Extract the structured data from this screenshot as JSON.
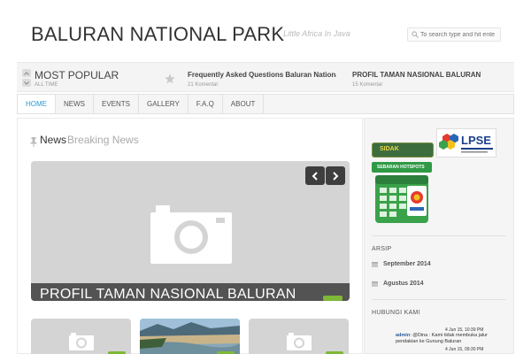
{
  "header": {
    "site_title": "BALURAN NATIONAL PARK",
    "tagline": "Little Africa In Java",
    "search_placeholder": "To search type and hit ente"
  },
  "popular": {
    "title": "MOST POPULAR",
    "subtitle": "ALL TIME",
    "items": [
      {
        "title": "Frequently Asked Questions Baluran National P",
        "comments": "21 Komentar"
      },
      {
        "title": "PROFIL TAMAN NASIONAL BALURAN",
        "comments": "15 Komentar"
      }
    ]
  },
  "nav": {
    "items": [
      "HOME",
      "NEWS",
      "EVENTS",
      "GALLERY",
      "F.A.Q",
      "ABOUT"
    ]
  },
  "main": {
    "section_title_bold": "News",
    "section_title_light": "Breaking News",
    "slider_caption": "PROFIL TAMAN NASIONAL BALURAN"
  },
  "sidebar": {
    "sidak_label": "SIDAK",
    "lpse_label": "LPSE",
    "hotspot_label": "SEBARAN HOTSPOTS",
    "archive_heading": "ARSIP",
    "archive_items": [
      "September 2014",
      "Agustus 2014"
    ],
    "contact_heading": "HUBUNGI KAMI",
    "comments": [
      {
        "date": "4 Jun 15, 10:39 PM",
        "author": "admin",
        "text": ": @Dina : Kami tidak membuka jalur pendakian ke Gunung Baluran"
      },
      {
        "date": "4 Jun 15, 09:30 PM"
      }
    ]
  },
  "colors": {
    "accent": "#2b9ad6",
    "badge_green": "#7fb737"
  }
}
